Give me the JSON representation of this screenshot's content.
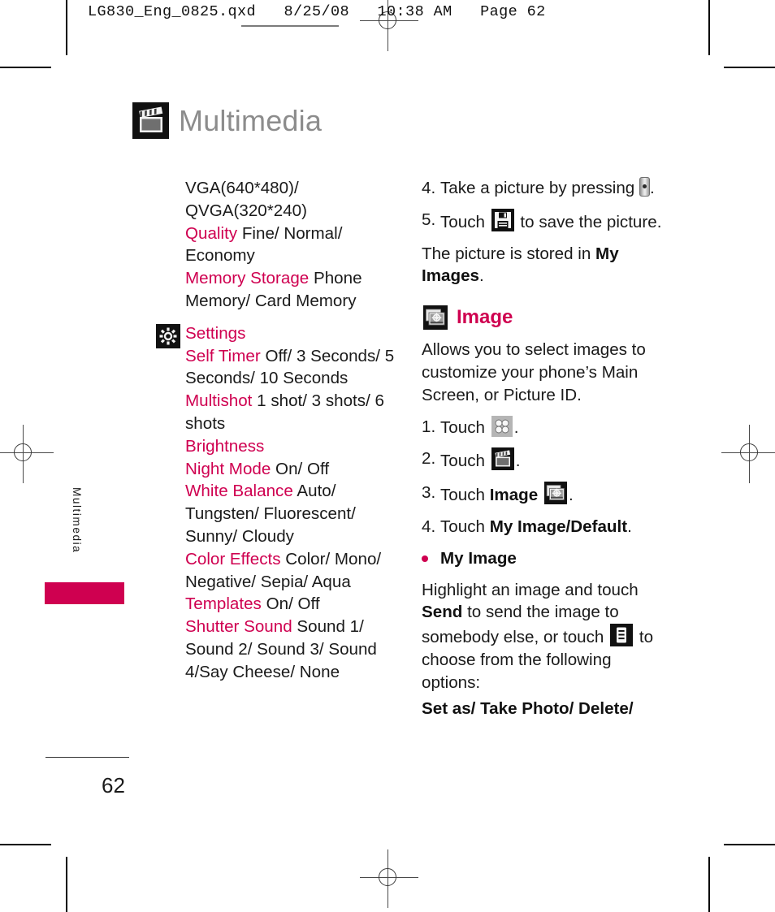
{
  "prepress": {
    "file_header": "LG830_Eng_0825.qxd   8/25/08   10:38 AM   Page 62"
  },
  "page": {
    "title": "Multimedia",
    "title_icon": "clapperboard-icon",
    "side_label": "Multimedia",
    "number": "62",
    "accent_color": "#cf0050",
    "title_color": "#8c8c8c"
  },
  "left_column": {
    "resolution_lines": [
      "VGA(640*480)/",
      "QVGA(320*240)"
    ],
    "settings_before": [
      {
        "key": "Quality",
        "value": "Fine/ Normal/ Economy"
      },
      {
        "key": "Memory Storage",
        "value": "Phone Memory/ Card Memory"
      }
    ],
    "settings_section": {
      "icon": "gear-icon",
      "heading": "Settings",
      "items": [
        {
          "key": "Self Timer",
          "value": "Off/ 3 Seconds/ 5 Seconds/ 10 Seconds"
        },
        {
          "key": "Multishot",
          "value": "1 shot/ 3 shots/ 6 shots"
        },
        {
          "key": "Brightness",
          "value": ""
        },
        {
          "key": "Night Mode",
          "value": "On/ Off"
        },
        {
          "key": "White Balance",
          "value": "Auto/ Tungsten/ Fluorescent/ Sunny/ Cloudy"
        },
        {
          "key": "Color Effects",
          "value": "Color/ Mono/ Negative/ Sepia/ Aqua"
        },
        {
          "key": "Templates",
          "value": "On/ Off"
        },
        {
          "key": "Shutter Sound",
          "value": "Sound 1/ Sound 2/ Sound 3/ Sound 4/Say Cheese/ None"
        }
      ]
    }
  },
  "right_column": {
    "camera_steps": [
      {
        "num": "4.",
        "before": "Take a picture by pressing",
        "icon": "camera-key-icon",
        "after": "."
      },
      {
        "num": "5.",
        "before": "Touch",
        "icon": "save-floppy-icon",
        "after": "to save the picture."
      }
    ],
    "stored_note": {
      "before": "The picture is stored in ",
      "bold": "My Images",
      "after": "."
    },
    "image_section": {
      "icon": "image-photos-icon",
      "heading": "Image",
      "intro": "Allows you to select images to customize your phone’s Main Screen, or Picture ID.",
      "steps": [
        {
          "num": "1.",
          "before": "Touch",
          "icon": "grid-four-dots-icon",
          "after": "."
        },
        {
          "num": "2.",
          "before": "Touch",
          "icon": "clapperboard-icon",
          "after": "."
        },
        {
          "num": "3.",
          "before": "Touch ",
          "bold": "Image",
          "icon": "image-photos-icon",
          "after": "."
        },
        {
          "num": "4.",
          "before": "Touch ",
          "bold": "My Image/Default",
          "after": "."
        }
      ],
      "bullet": {
        "label": "My Image",
        "text_part1": "Highlight an image and touch ",
        "bold1": "Send",
        "text_part2": " to send the image to somebody else, or touch",
        "icon": "menu-list-icon",
        "text_part3": "to choose from the following options:",
        "options_bold": "Set as/ Take Photo/ Delete/"
      }
    }
  }
}
